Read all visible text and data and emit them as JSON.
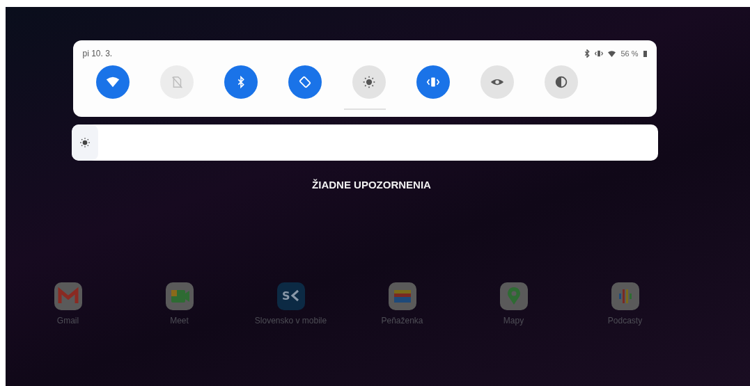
{
  "quick_settings": {
    "date": "pi 10. 3.",
    "battery": "56 %",
    "tiles": [
      {
        "kind": "wifi",
        "on": true,
        "disabled": false
      },
      {
        "kind": "sim",
        "on": false,
        "disabled": true
      },
      {
        "kind": "bluetooth",
        "on": true,
        "disabled": false
      },
      {
        "kind": "rotate",
        "on": true,
        "disabled": false
      },
      {
        "kind": "flashlight",
        "on": false,
        "disabled": false
      },
      {
        "kind": "vibrate",
        "on": true,
        "disabled": false
      },
      {
        "kind": "eye",
        "on": false,
        "disabled": false
      },
      {
        "kind": "contrast",
        "on": false,
        "disabled": false
      }
    ],
    "brightness": {
      "level": 0
    }
  },
  "notifications": {
    "empty_text": "ŽIADNE UPOZORNENIA"
  },
  "apps": [
    {
      "kind": "gmail",
      "label": "Gmail"
    },
    {
      "kind": "meet",
      "label": "Meet"
    },
    {
      "kind": "sk",
      "label": "Slovensko v mobile",
      "logo_text": "S"
    },
    {
      "kind": "wallet",
      "label": "Peňaženka"
    },
    {
      "kind": "maps",
      "label": "Mapy"
    },
    {
      "kind": "podcasts",
      "label": "Podcasty"
    }
  ]
}
